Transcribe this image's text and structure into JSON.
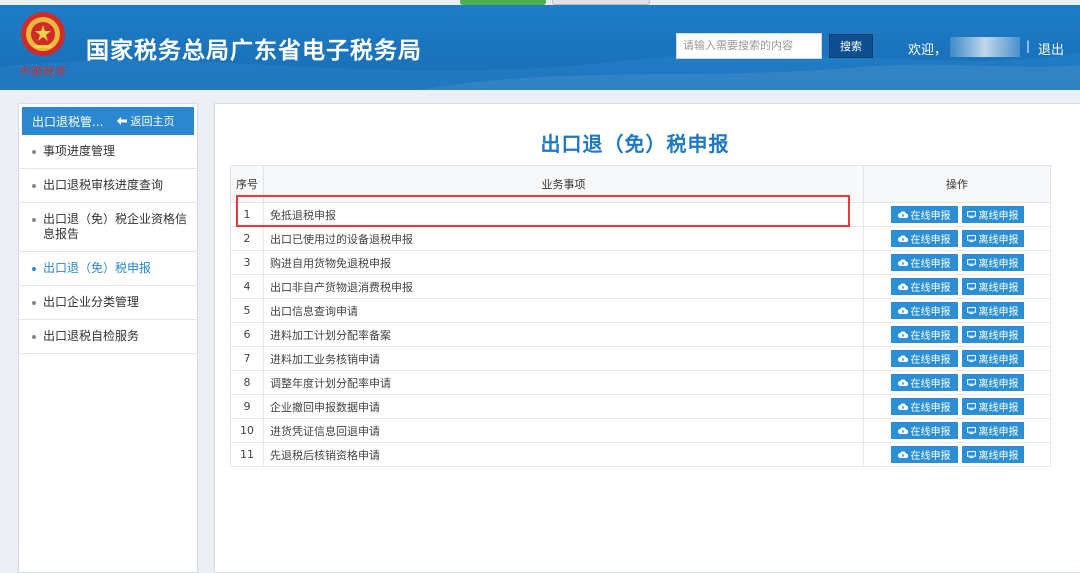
{
  "header": {
    "title": "国家税务总局广东省电子税务局",
    "logo_text": "中国税务",
    "search_placeholder": "请输入需要搜索的内容",
    "search_button": "搜索",
    "welcome": "欢迎，",
    "separator": "|",
    "logout": "退出"
  },
  "sidebar": {
    "header_title": "出口退税管...",
    "back_label": "返回主页",
    "items": [
      {
        "label": "事项进度管理"
      },
      {
        "label": "出口退税审核进度查询"
      },
      {
        "label": "出口退（免）税企业资格信息报告"
      },
      {
        "label": "出口退（免）税申报",
        "active": true
      },
      {
        "label": "出口企业分类管理"
      },
      {
        "label": "出口退税自检服务"
      }
    ]
  },
  "main": {
    "title": "出口退（免）税申报",
    "columns": [
      "序号",
      "业务事项",
      "操作"
    ],
    "online_label": "在线申报",
    "offline_label": "离线申报",
    "rows": [
      {
        "no": "1",
        "item": "免抵退税申报"
      },
      {
        "no": "2",
        "item": "出口已使用过的设备退税申报"
      },
      {
        "no": "3",
        "item": "购进自用货物免退税申报"
      },
      {
        "no": "4",
        "item": "出口非自产货物退消费税申报"
      },
      {
        "no": "5",
        "item": "出口信息查询申请"
      },
      {
        "no": "6",
        "item": "进料加工计划分配率备案"
      },
      {
        "no": "7",
        "item": "进料加工业务核销申请"
      },
      {
        "no": "8",
        "item": "调整年度计划分配率申请"
      },
      {
        "no": "9",
        "item": "企业撤回申报数据申请"
      },
      {
        "no": "10",
        "item": "进货凭证信息回退申请"
      },
      {
        "no": "11",
        "item": "先退税后核销资格申请"
      }
    ]
  },
  "colors": {
    "header_blue": "#1b74bd",
    "accent_blue": "#2b87cf",
    "button_blue": "#2b8fd6",
    "highlight_red": "#e83a3a"
  }
}
